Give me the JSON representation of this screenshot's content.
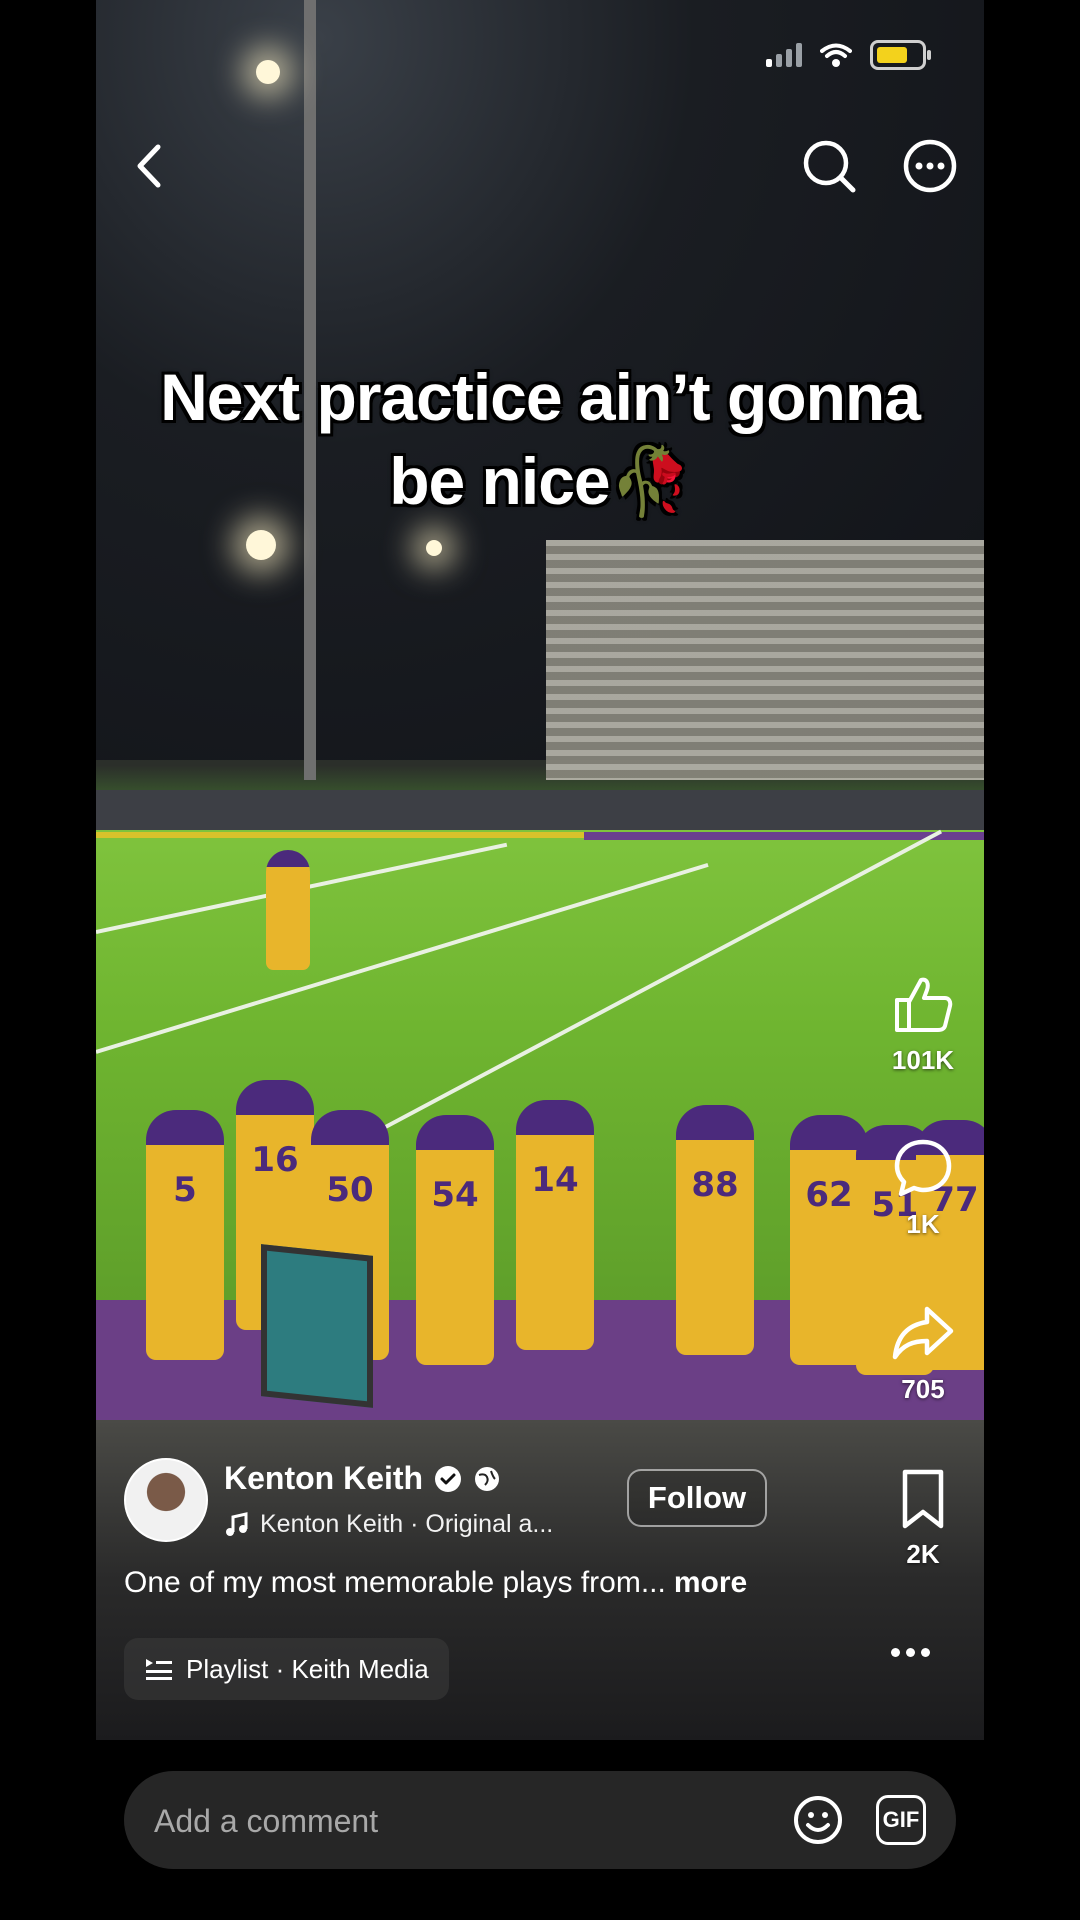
{
  "video": {
    "caption_line1": "Next practice ain’t gonna",
    "caption_line2": "be nice🥀",
    "jersey_numbers": [
      "5",
      "16",
      "50",
      "54",
      "14",
      "88",
      "62",
      "51",
      "77"
    ]
  },
  "top_bar": {
    "back_icon": "chevron-left-icon",
    "search_icon": "search-icon",
    "more_icon": "more-horizontal-icon"
  },
  "rail": {
    "like_count": "101K",
    "comment_count": "1K",
    "share_count": "705",
    "save_count": "2K"
  },
  "author": {
    "name": "Kenton Keith",
    "audio": "Kenton Keith · Original a...",
    "follow_label": "Follow"
  },
  "description": {
    "text": "One of my most memorable plays from...",
    "more_label": "more"
  },
  "playlist": {
    "label": "Playlist · Keith Media"
  },
  "comment": {
    "placeholder": "Add a comment",
    "gif_label": "GIF"
  },
  "colors": {
    "jersey_gold": "#e8b52b",
    "helmet_purple": "#4b2a7c",
    "battery": "#f3d21c",
    "background": "#000000"
  }
}
